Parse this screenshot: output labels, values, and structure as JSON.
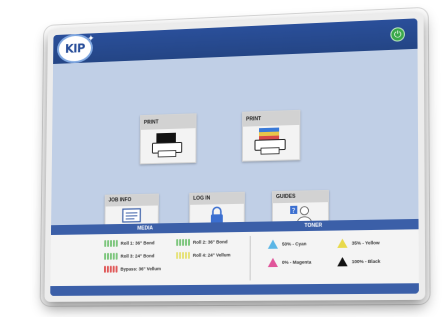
{
  "header": {
    "logo_text": "KIP",
    "power_icon": "power-icon"
  },
  "tiles": {
    "print_1": {
      "label": "PRINT",
      "icon": "printer-icon"
    },
    "print_2": {
      "label": "PRINT",
      "icon": "color-printer-icon"
    },
    "job_info": {
      "label": "JOB INFO",
      "icon": "monitor-icon"
    },
    "log_in": {
      "label": "LOG IN",
      "icon": "lock-icon"
    },
    "guides": {
      "label": "GUIDES",
      "icon": "help-user-icon"
    }
  },
  "media": {
    "title": "MEDIA",
    "rolls": [
      {
        "label": "Roll 1: 36\" Bond",
        "color": "#7dc67d"
      },
      {
        "label": "Roll 2: 36\" Bond",
        "color": "#7dc67d"
      },
      {
        "label": "Roll 3: 24\" Bond",
        "color": "#7dc67d"
      },
      {
        "label": "Roll 4: 24\" Vellum",
        "color": "#e6e27a"
      },
      {
        "label": "Bypass: 36\" Vellum",
        "color": "#e05a5a"
      }
    ]
  },
  "toner": {
    "title": "TONER",
    "items": [
      {
        "label": "50% - Cyan",
        "color": "#5bb6e6"
      },
      {
        "label": "35% - Yellow",
        "color": "#e8d94a"
      },
      {
        "label": "0% - Magenta",
        "color": "#e0559a"
      },
      {
        "label": "100% - Black",
        "color": "#111111"
      }
    ]
  }
}
